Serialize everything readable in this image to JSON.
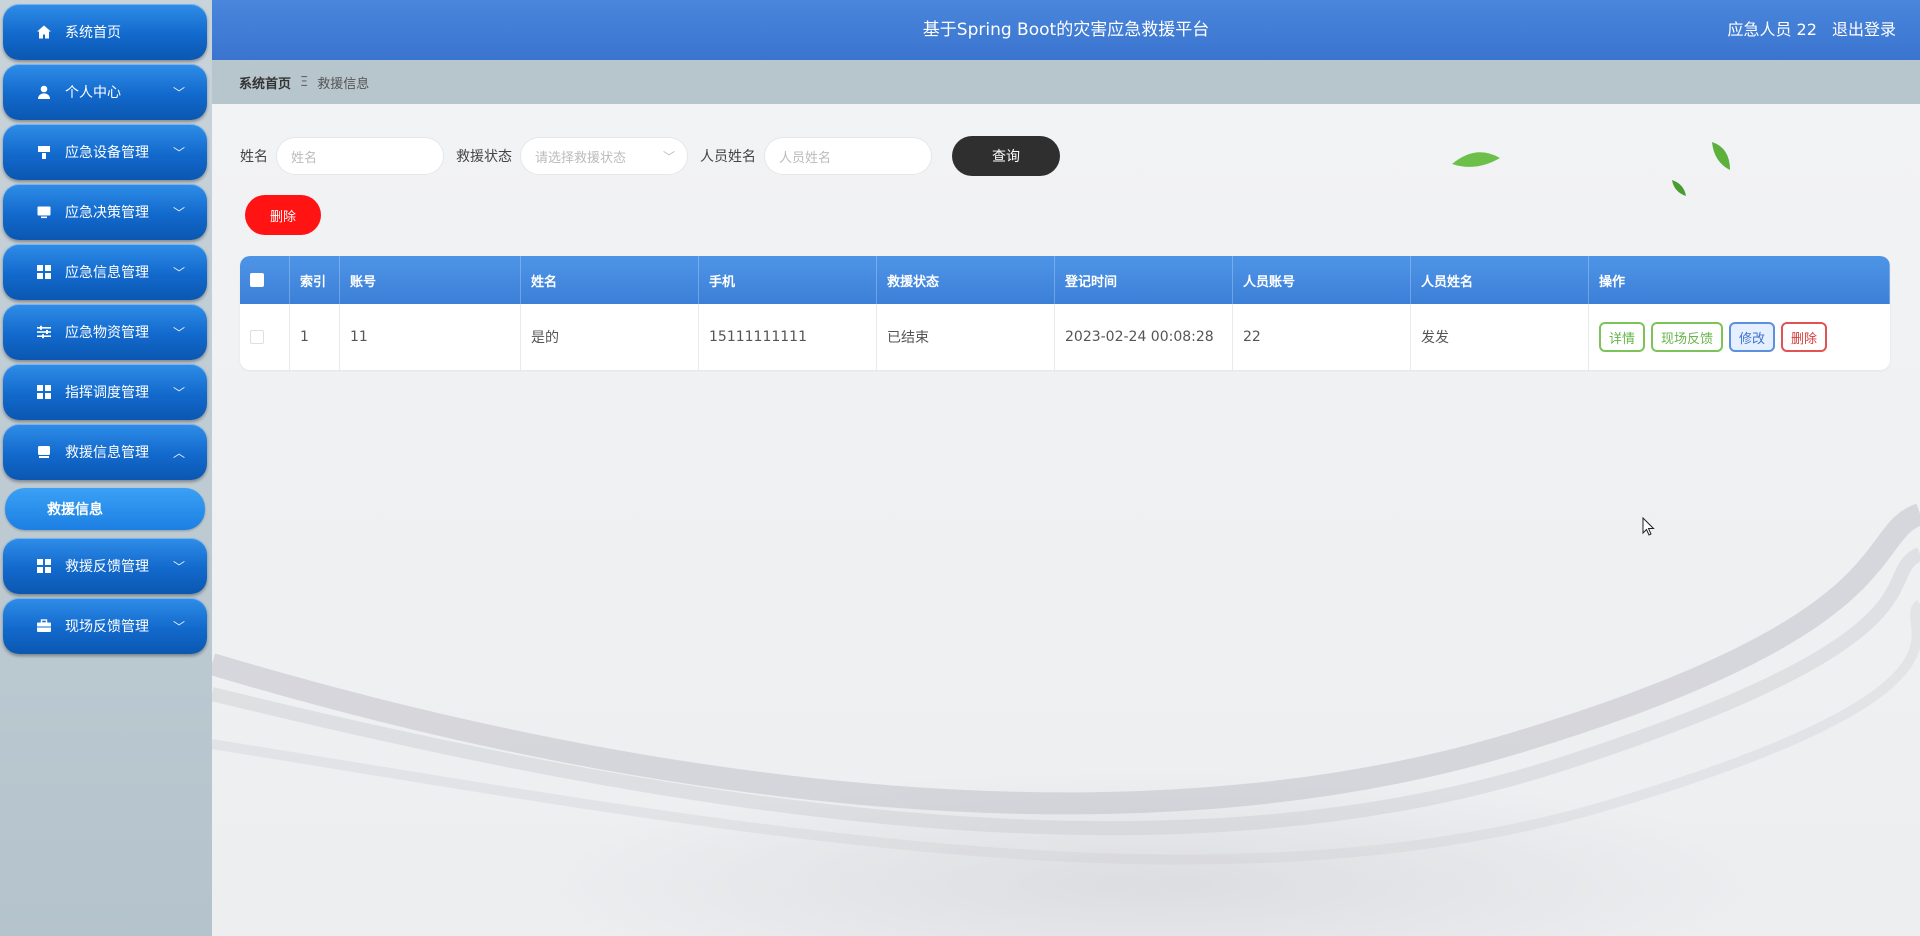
{
  "header": {
    "title": "基于Spring Boot的灾害应急救援平台",
    "user": "应急人员 22",
    "logout": "退出登录"
  },
  "sidebar": {
    "items": [
      {
        "label": "系统首页",
        "icon": "home-icon",
        "expandable": false
      },
      {
        "label": "个人中心",
        "icon": "user-icon",
        "expandable": true
      },
      {
        "label": "应急设备管理",
        "icon": "device-icon",
        "expandable": true
      },
      {
        "label": "应急决策管理",
        "icon": "monitor-icon",
        "expandable": true
      },
      {
        "label": "应急信息管理",
        "icon": "grid-icon",
        "expandable": true
      },
      {
        "label": "应急物资管理",
        "icon": "sliders-icon",
        "expandable": true
      },
      {
        "label": "指挥调度管理",
        "icon": "grid-icon",
        "expandable": true
      },
      {
        "label": "救援信息管理",
        "icon": "screen-icon",
        "expandable": true,
        "expanded": true
      },
      {
        "label": "救援反馈管理",
        "icon": "grid-icon",
        "expandable": true
      },
      {
        "label": "现场反馈管理",
        "icon": "briefcase-icon",
        "expandable": true
      }
    ],
    "active_sub": "救援信息"
  },
  "breadcrumb": {
    "home": "系统首页",
    "separator": "Ξ",
    "current": "救援信息"
  },
  "search": {
    "name_label": "姓名",
    "name_placeholder": "姓名",
    "status_label": "救援状态",
    "status_placeholder": "请选择救援状态",
    "person_label": "人员姓名",
    "person_placeholder": "人员姓名",
    "query_button": "查询"
  },
  "actions": {
    "delete_button": "删除"
  },
  "table": {
    "columns": [
      "索引",
      "账号",
      "姓名",
      "手机",
      "救援状态",
      "登记时间",
      "人员账号",
      "人员姓名",
      "操作"
    ],
    "rows": [
      {
        "index": "1",
        "account": "11",
        "name": "是的",
        "phone": "15111111111",
        "status": "已结束",
        "time": "2023-02-24 00:08:28",
        "staff_account": "22",
        "staff_name": "发发"
      }
    ],
    "row_actions": {
      "detail": "详情",
      "feedback": "现场反馈",
      "edit": "修改",
      "delete": "删除"
    }
  },
  "colors": {
    "header": "#3f7bd5",
    "menu": "#1269cc",
    "query_button": "#2f2f2f",
    "delete_button": "#ff1313"
  }
}
